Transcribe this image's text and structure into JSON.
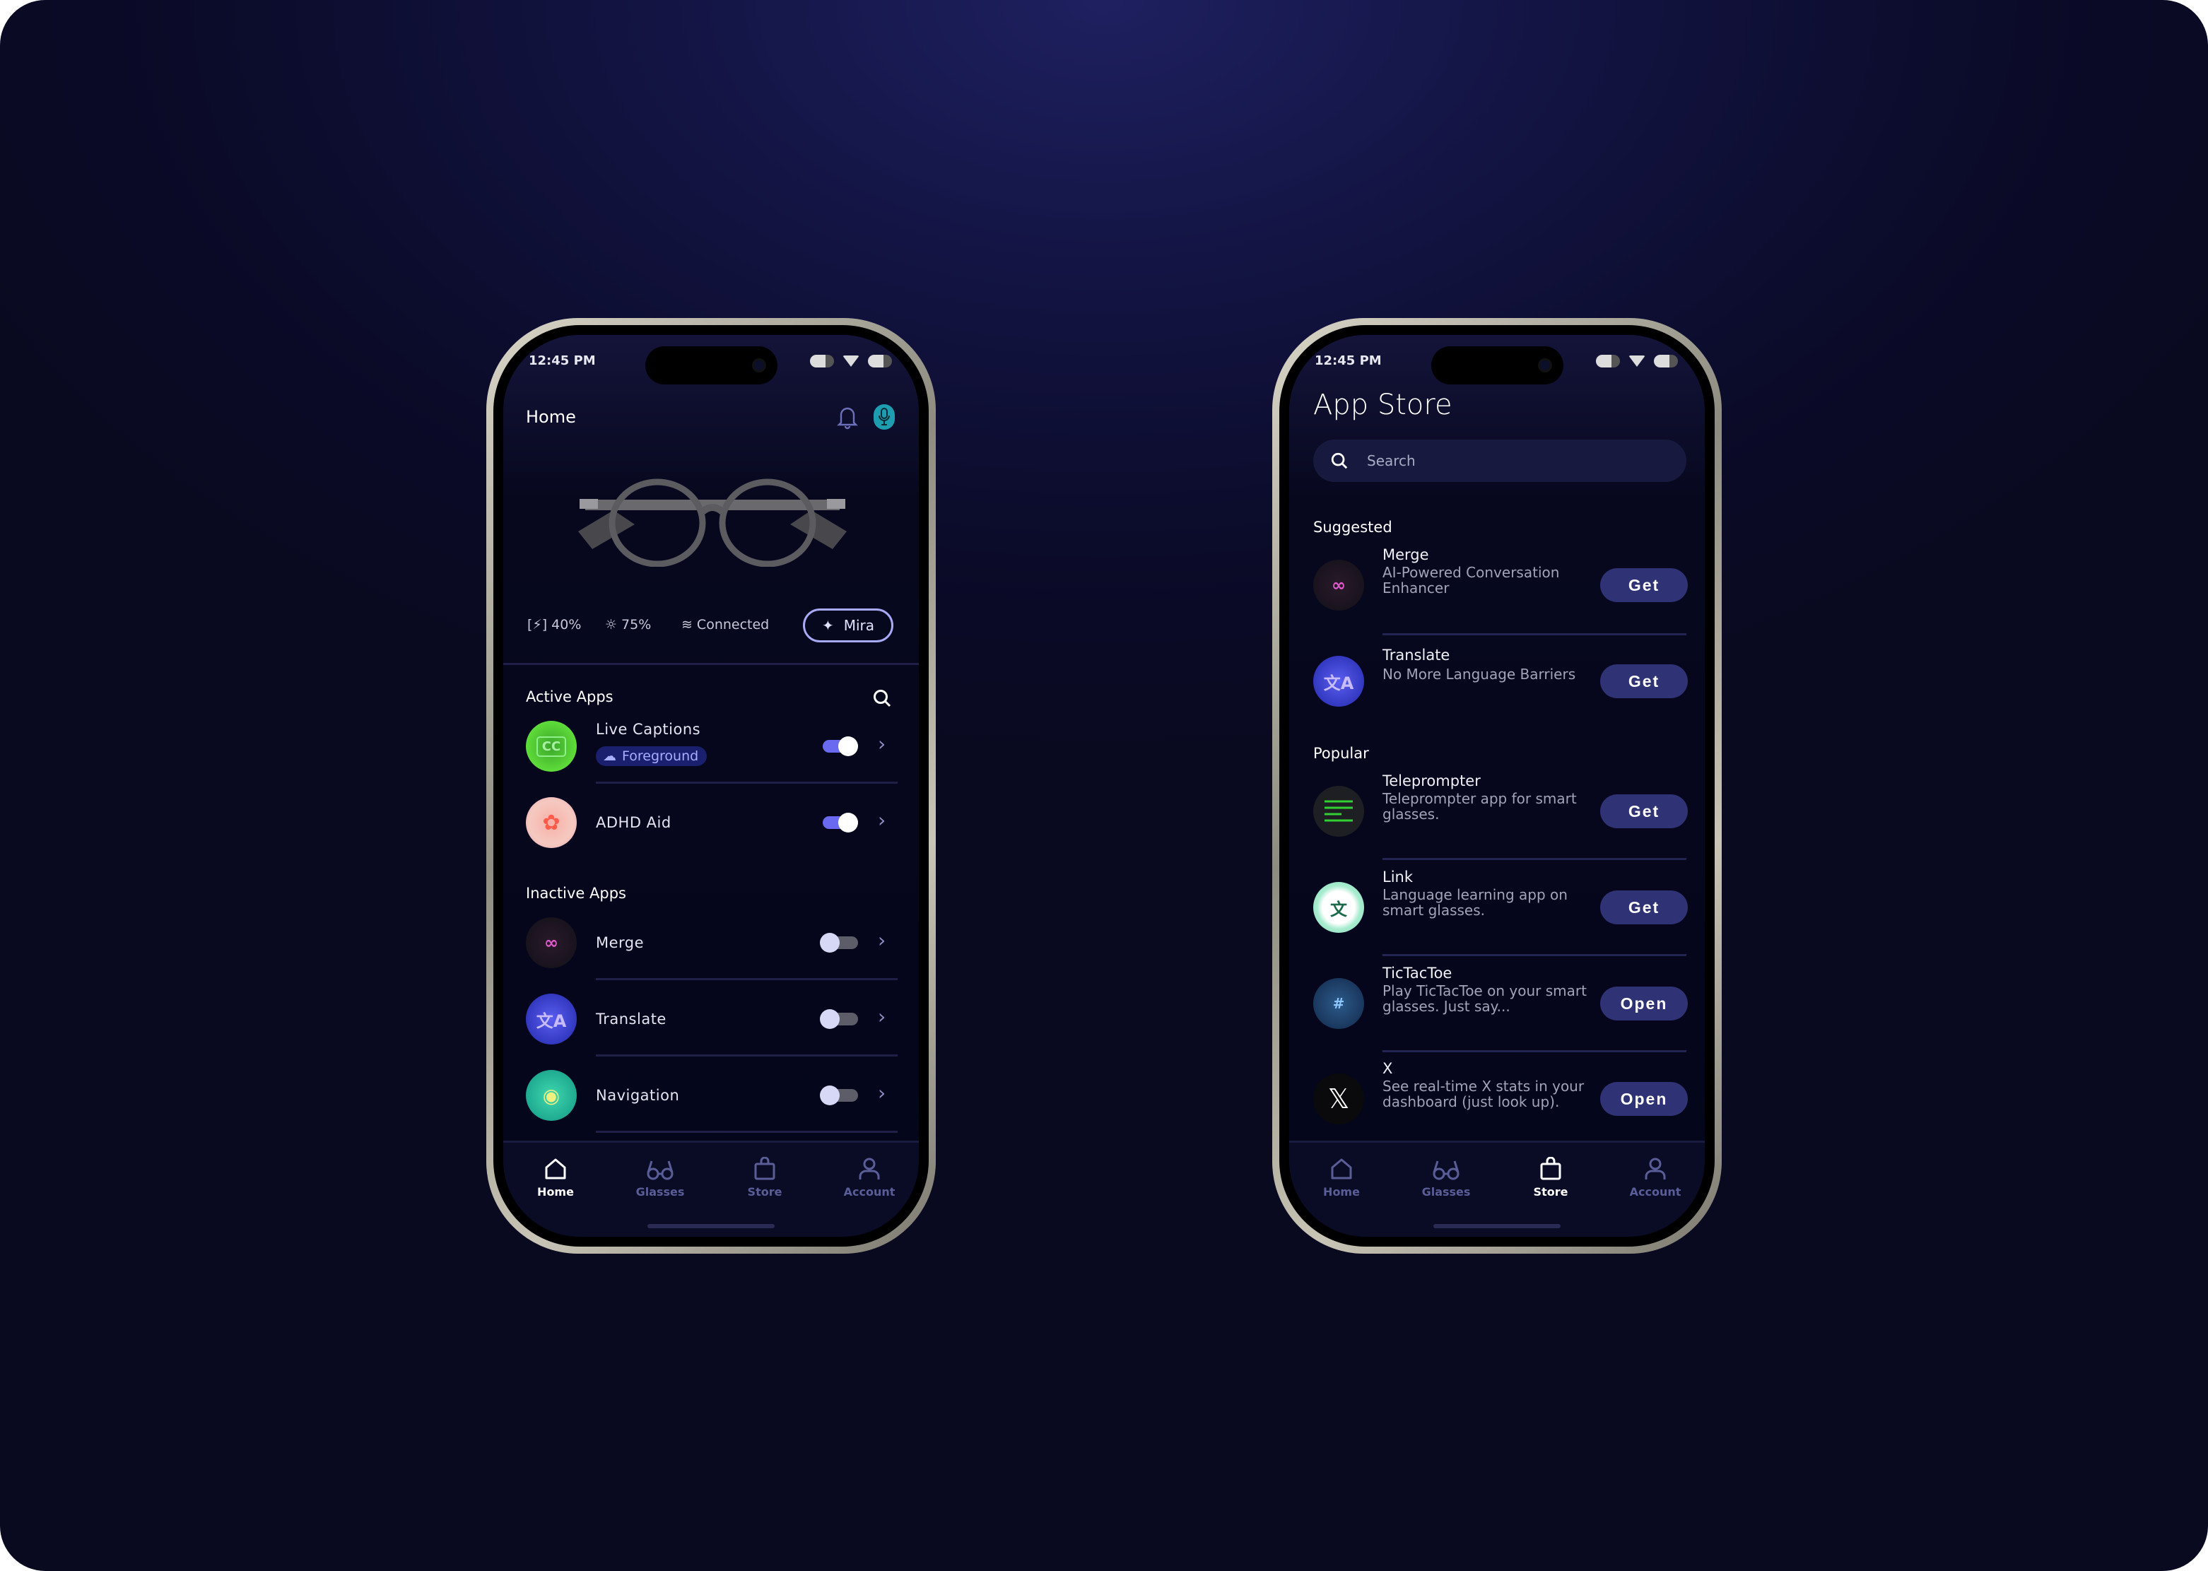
{
  "status": {
    "time": "12:45 PM"
  },
  "home": {
    "title": "Home",
    "stats": {
      "battery": "40%",
      "brightness": "75%",
      "connection": "Connected"
    },
    "mira_label": "Mira",
    "active_title": "Active Apps",
    "inactive_title": "Inactive Apps",
    "active_apps": [
      {
        "name": "Live Captions",
        "badge": "Foreground",
        "enabled": true
      },
      {
        "name": "ADHD Aid",
        "enabled": true
      }
    ],
    "inactive_apps": [
      {
        "name": "Merge",
        "enabled": false
      },
      {
        "name": "Translate",
        "enabled": false
      },
      {
        "name": "Navigation",
        "enabled": false
      }
    ]
  },
  "store": {
    "title": "App Store",
    "search_placeholder": "Search",
    "suggested_title": "Suggested",
    "popular_title": "Popular",
    "suggested": [
      {
        "name": "Merge",
        "desc": "AI-Powered Conversation Enhancer",
        "action": "Get"
      },
      {
        "name": "Translate",
        "desc": "No More Language Barriers",
        "action": "Get"
      }
    ],
    "popular": [
      {
        "name": "Teleprompter",
        "desc": "Teleprompter app for smart glasses.",
        "action": "Get"
      },
      {
        "name": "Link",
        "desc": "Language learning app on smart glasses.",
        "action": "Get"
      },
      {
        "name": "TicTacToe",
        "desc": "Play TicTacToe on your smart glasses. Just say...",
        "action": "Open"
      },
      {
        "name": "X",
        "desc": "See real-time X stats in your dashboard (just look up).",
        "action": "Open"
      }
    ]
  },
  "tabs": [
    "Home",
    "Glasses",
    "Store",
    "Account"
  ],
  "colors": {
    "accent": "#6a6af0",
    "button": "#303276",
    "mic": "#1f9db0",
    "mira_border": "#a8aaf5"
  }
}
